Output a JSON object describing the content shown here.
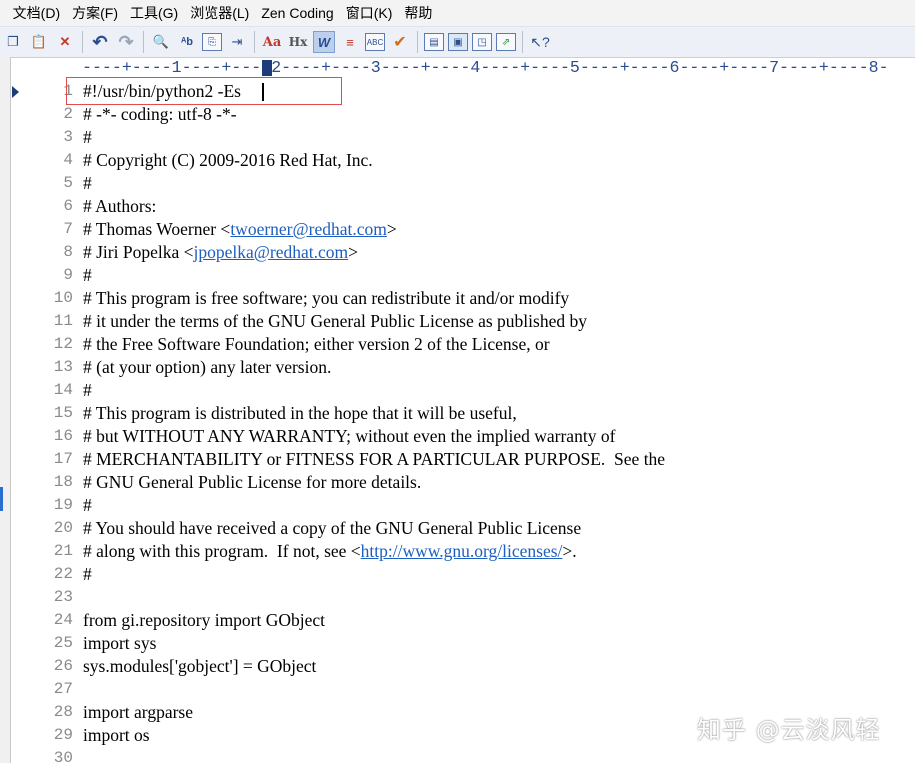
{
  "menu": [
    "文档(D)",
    "方案(F)",
    "工具(G)",
    "浏览器(L)",
    "Zen Coding",
    "窗口(K)",
    "帮助"
  ],
  "menu_prefix": ")",
  "toolbar": {
    "icons": [
      "copy-icon",
      "paste-icon",
      "delete-icon",
      "undo-icon",
      "redo-icon",
      "find-icon",
      "replace-icon",
      "find-in-files-icon",
      "indent-icon",
      "font-icon",
      "heading-icon",
      "word-wrap-icon",
      "line-numbers-icon",
      "spell-abc-icon",
      "checkmark-icon",
      "panel1-icon",
      "panel2-icon",
      "preview-icon",
      "export-icon",
      "help-pointer-icon"
    ]
  },
  "ruler": "----+----1----+----2----+----3----+----4----+----5----+----6----+----7----+----8-",
  "lines": [
    {
      "n": "1",
      "text": "#!/usr/bin/python2 -Es"
    },
    {
      "n": "2",
      "text": "# -*- coding: utf-8 -*-"
    },
    {
      "n": "3",
      "text": "#"
    },
    {
      "n": "4",
      "text": "# Copyright (C) 2009-2016 Red Hat, Inc."
    },
    {
      "n": "5",
      "text": "#"
    },
    {
      "n": "6",
      "text": "# Authors:"
    },
    {
      "n": "7",
      "pre": "# Thomas Woerner <",
      "link": "twoerner@redhat.com",
      "post": ">"
    },
    {
      "n": "8",
      "pre": "# Jiri Popelka <",
      "link": "jpopelka@redhat.com",
      "post": ">"
    },
    {
      "n": "9",
      "text": "#"
    },
    {
      "n": "10",
      "text": "# This program is free software; you can redistribute it and/or modify"
    },
    {
      "n": "11",
      "text": "# it under the terms of the GNU General Public License as published by"
    },
    {
      "n": "12",
      "text": "# the Free Software Foundation; either version 2 of the License, or"
    },
    {
      "n": "13",
      "text": "# (at your option) any later version."
    },
    {
      "n": "14",
      "text": "#"
    },
    {
      "n": "15",
      "text": "# This program is distributed in the hope that it will be useful,"
    },
    {
      "n": "16",
      "text": "# but WITHOUT ANY WARRANTY; without even the implied warranty of"
    },
    {
      "n": "17",
      "text": "# MERCHANTABILITY or FITNESS FOR A PARTICULAR PURPOSE.  See the"
    },
    {
      "n": "18",
      "text": "# GNU General Public License for more details."
    },
    {
      "n": "19",
      "text": "#"
    },
    {
      "n": "20",
      "text": "# You should have received a copy of the GNU General Public License"
    },
    {
      "n": "21",
      "pre": "# along with this program.  If not, see <",
      "link": "http://www.gnu.org/licenses/",
      "post": ">."
    },
    {
      "n": "22",
      "text": "#"
    },
    {
      "n": "23",
      "text": ""
    },
    {
      "n": "24",
      "text": "from gi.repository import GObject"
    },
    {
      "n": "25",
      "text": "import sys"
    },
    {
      "n": "26",
      "text": "sys.modules['gobject'] = GObject"
    },
    {
      "n": "27",
      "text": ""
    },
    {
      "n": "28",
      "text": "import argparse"
    },
    {
      "n": "29",
      "text": "import os"
    },
    {
      "n": "30",
      "text": ""
    }
  ],
  "watermark": "知乎 @云淡风轻",
  "colors": {
    "highlight_box": "#e34c4c",
    "link": "#1d5fbf",
    "line_number": "#8a8a8a",
    "ruler": "#2a4d8f"
  }
}
